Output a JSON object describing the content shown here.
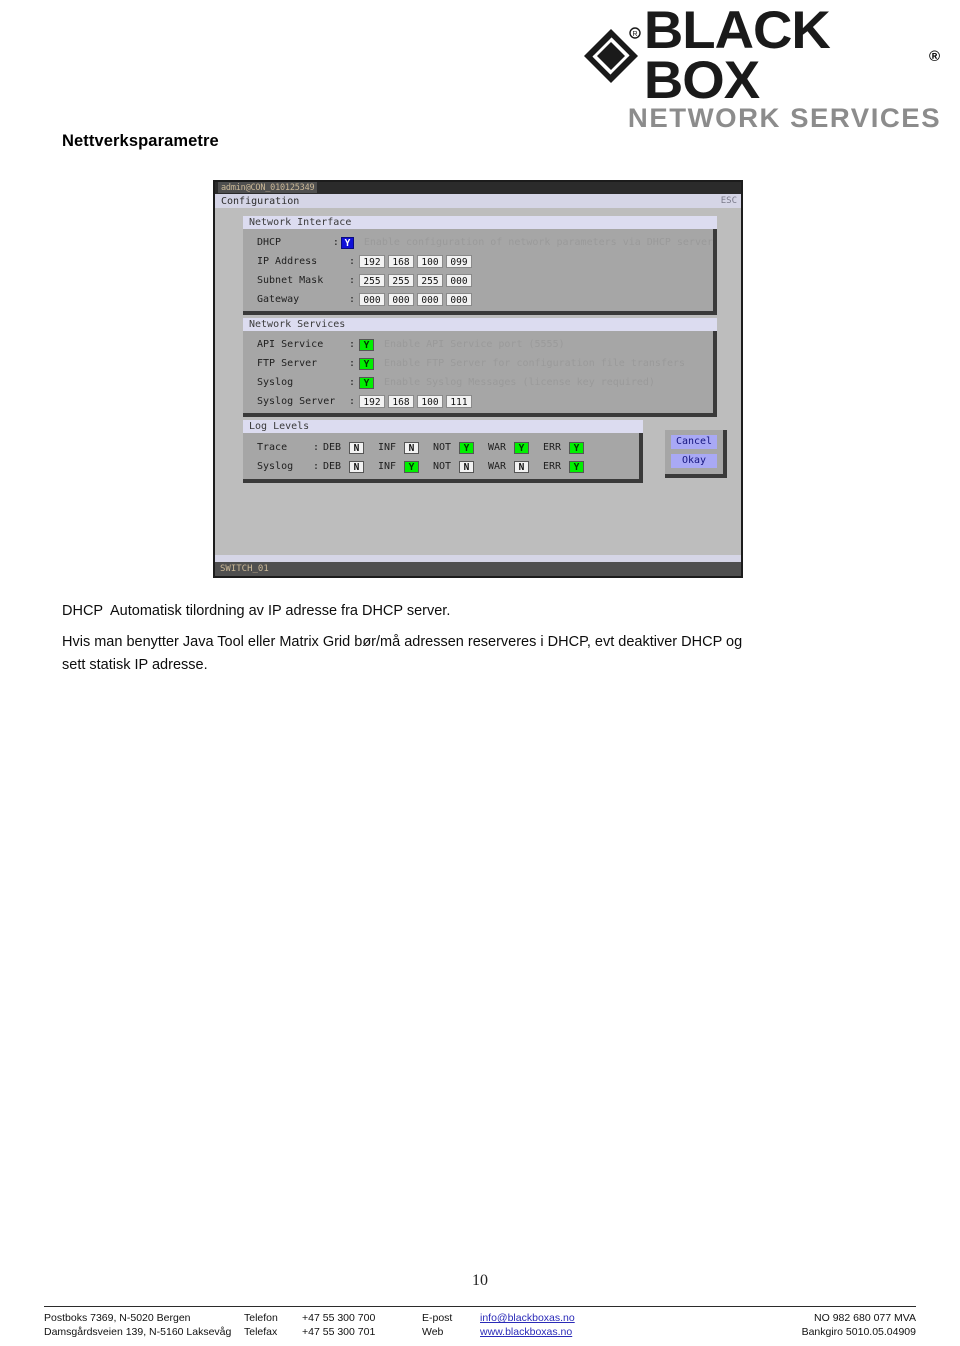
{
  "logo": {
    "brand": "BLACK BOX",
    "registered_mark": "®",
    "tagline": "NETWORK SERVICES",
    "diamond_icon": "black-box-diamond-icon"
  },
  "heading": "Nettverksparametre",
  "terminal": {
    "title": "admin@CON_010125349",
    "menu_label": "Configuration",
    "esc_label": "ESC",
    "status_label": "SWITCH_01",
    "groups": [
      {
        "title": "Network Interface",
        "rows": [
          {
            "label": "DHCP",
            "colon": ":",
            "type": "checkbox",
            "value": "Y",
            "state": "selected",
            "hint": "Enable configuration of network parameters via DHCP server"
          },
          {
            "label": "IP Address",
            "colon": ":",
            "type": "ipv4",
            "octets": [
              "192",
              "168",
              "100",
              "099"
            ]
          },
          {
            "label": "Subnet Mask",
            "colon": ":",
            "type": "ipv4",
            "octets": [
              "255",
              "255",
              "255",
              "000"
            ]
          },
          {
            "label": "Gateway",
            "colon": ":",
            "type": "ipv4",
            "octets": [
              "000",
              "000",
              "000",
              "000"
            ]
          }
        ]
      },
      {
        "title": "Network Services",
        "rows": [
          {
            "label": "API Service",
            "colon": ":",
            "type": "checkbox",
            "value": "Y",
            "state": "on",
            "hint": "Enable API Service port (5555)"
          },
          {
            "label": "FTP Server",
            "colon": ":",
            "type": "checkbox",
            "value": "Y",
            "state": "on",
            "hint": "Enable FTP Server for configuration file transfers"
          },
          {
            "label": "Syslog",
            "colon": ":",
            "type": "checkbox",
            "value": "Y",
            "state": "on",
            "hint": "Enable Syslog Messages (license key required)"
          },
          {
            "label": "Syslog Server",
            "colon": ":",
            "type": "ipv4",
            "octets": [
              "192",
              "168",
              "100",
              "111"
            ]
          }
        ]
      }
    ],
    "log_levels": {
      "title": "Log Levels",
      "columns": [
        "DEB",
        "INF",
        "NOT",
        "WAR",
        "ERR"
      ],
      "rows": [
        {
          "label": "Trace",
          "colon": ":",
          "values": [
            "N",
            "N",
            "Y",
            "Y",
            "Y"
          ]
        },
        {
          "label": "Syslog",
          "colon": ":",
          "values": [
            "N",
            "Y",
            "N",
            "N",
            "Y"
          ]
        }
      ]
    },
    "buttons": [
      {
        "label": "Cancel"
      },
      {
        "label": "Okay"
      }
    ]
  },
  "body": {
    "p1_term": "DHCP",
    "p1_text": "Automatisk tilordning av IP adresse fra DHCP server.",
    "p2_text": "Hvis man benytter Java Tool eller Matrix Grid bør/må adressen reserveres i DHCP, evt deaktiver DHCP og sett statisk IP adresse."
  },
  "page_number": "10",
  "footer": {
    "address_line1": "Postboks 7369, N-5020 Bergen",
    "address_line2": "Damsgårdsveien 139, N-5160 Laksevåg",
    "tel_key1": "Telefon",
    "tel_key2": "Telefax",
    "tel_val1": "+47 55 300 700",
    "tel_val2": "+47 55 300 701",
    "web_key1": "E-post",
    "web_key2": "Web",
    "web_val1": "info@blackboxas.no",
    "web_val2": "www.blackboxas.no",
    "right_line1": "NO 982 680 077 MVA",
    "right_line2": "Bankgiro 5010.05.04909"
  }
}
